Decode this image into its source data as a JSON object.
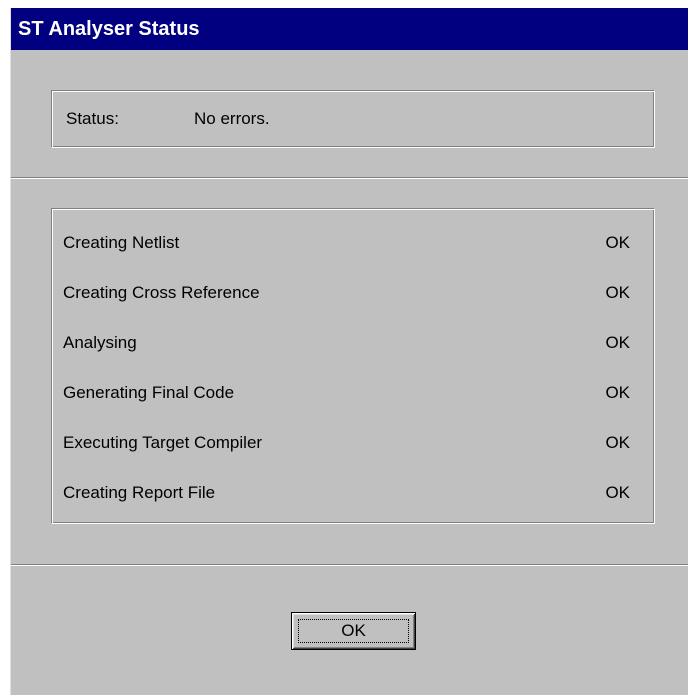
{
  "window": {
    "title": "ST Analyser Status"
  },
  "status": {
    "label": "Status:",
    "value": "No errors."
  },
  "steps": [
    {
      "label": "Creating Netlist",
      "result": "OK"
    },
    {
      "label": "Creating Cross Reference",
      "result": "OK"
    },
    {
      "label": "Analysing",
      "result": "OK"
    },
    {
      "label": "Generating Final Code",
      "result": "OK"
    },
    {
      "label": "Executing Target Compiler",
      "result": "OK"
    },
    {
      "label": "Creating Report File",
      "result": "OK"
    }
  ],
  "buttons": {
    "ok_label": "OK"
  },
  "colors": {
    "title_bar": "#000080",
    "face": "#c0c0c0"
  }
}
